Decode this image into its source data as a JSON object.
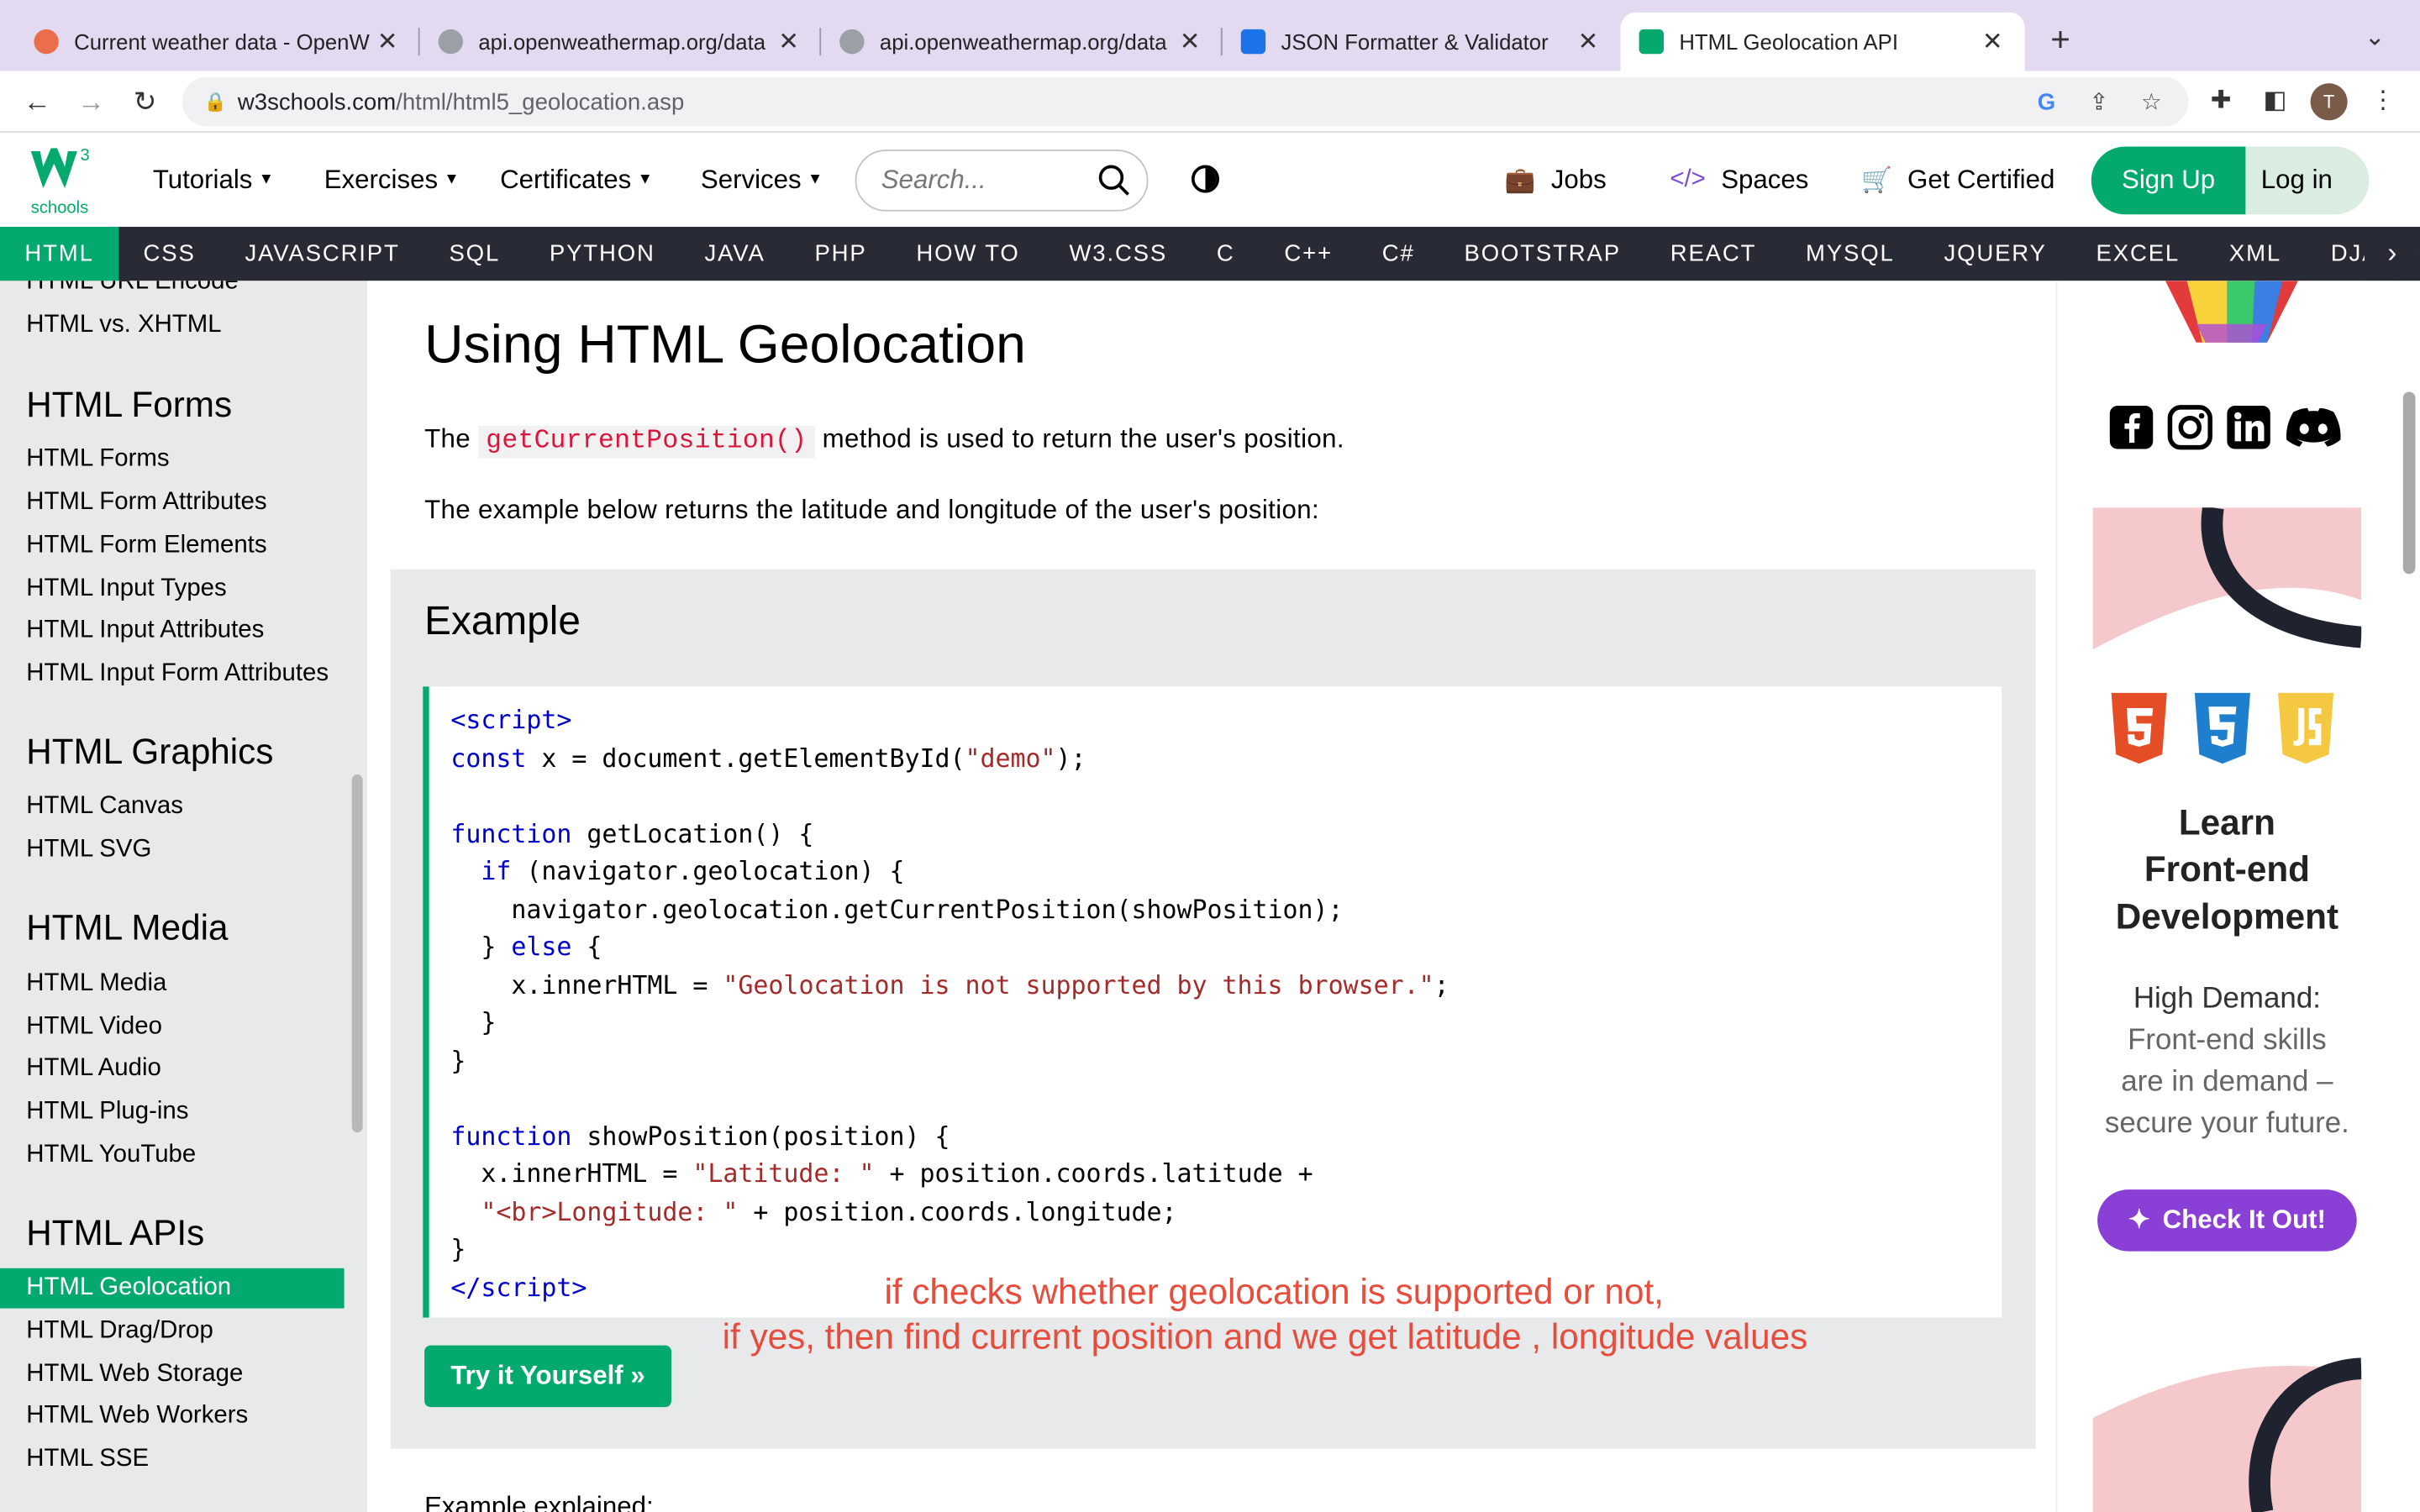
{
  "browser": {
    "tabs": [
      {
        "title": "Current weather data - OpenW",
        "favicon_color": "#eb6e4b"
      },
      {
        "title": "api.openweathermap.org/data",
        "favicon_color": "#9aa0a6"
      },
      {
        "title": "api.openweathermap.org/data",
        "favicon_color": "#9aa0a6"
      },
      {
        "title": "JSON Formatter & Validator",
        "favicon_color": "#1a73e8"
      },
      {
        "title": "HTML Geolocation API",
        "favicon_color": "#04aa6d"
      }
    ],
    "url_host": "w3schools.com",
    "url_path": "/html/html5_geolocation.asp",
    "profile_initial": "T"
  },
  "nav": {
    "logo_sup": "3",
    "logo_text": "schools",
    "menus": [
      "Tutorials",
      "Exercises",
      "Certificates",
      "Services"
    ],
    "search_placeholder": "Search...",
    "jobs": "Jobs",
    "spaces": "Spaces",
    "get_certified": "Get Certified",
    "sign_up": "Sign Up",
    "log_in": "Log in"
  },
  "subnav": [
    "HTML",
    "CSS",
    "JAVASCRIPT",
    "SQL",
    "PYTHON",
    "JAVA",
    "PHP",
    "HOW TO",
    "W3.CSS",
    "C",
    "C++",
    "C#",
    "BOOTSTRAP",
    "REACT",
    "MYSQL",
    "JQUERY",
    "EXCEL",
    "XML",
    "DJANGO"
  ],
  "sidebar": {
    "top_links": [
      "HTML URL Encode",
      "HTML vs. XHTML"
    ],
    "forms_head": "HTML Forms",
    "forms": [
      "HTML Forms",
      "HTML Form Attributes",
      "HTML Form Elements",
      "HTML Input Types",
      "HTML Input Attributes",
      "HTML Input Form Attributes"
    ],
    "graphics_head": "HTML Graphics",
    "graphics": [
      "HTML Canvas",
      "HTML SVG"
    ],
    "media_head": "HTML Media",
    "media": [
      "HTML Media",
      "HTML Video",
      "HTML Audio",
      "HTML Plug-ins",
      "HTML YouTube"
    ],
    "apis_head": "HTML APIs",
    "apis": [
      "HTML Geolocation",
      "HTML Drag/Drop",
      "HTML Web Storage",
      "HTML Web Workers",
      "HTML SSE"
    ]
  },
  "main": {
    "title": "Using HTML Geolocation",
    "p1_before": "The ",
    "p1_code": "getCurrentPosition()",
    "p1_after": " method is used to return the user's position.",
    "p2": "The example below returns the latitude and longitude of the user's position:",
    "example_heading": "Example",
    "try_button": "Try it Yourself »",
    "annotation_line1": "if checks whether geolocation is supported or not,",
    "annotation_line2": "if yes, then find current position and we get latitude , longitude values",
    "explained": "Example explained:"
  },
  "right": {
    "ad_title_lines": [
      "Learn",
      "Front-end",
      "Development"
    ],
    "ad_subtitle": "High Demand:",
    "ad_body_lines": [
      "Front-end skills",
      "are in demand –",
      "secure your future."
    ],
    "ad_button": "Check It Out!"
  }
}
